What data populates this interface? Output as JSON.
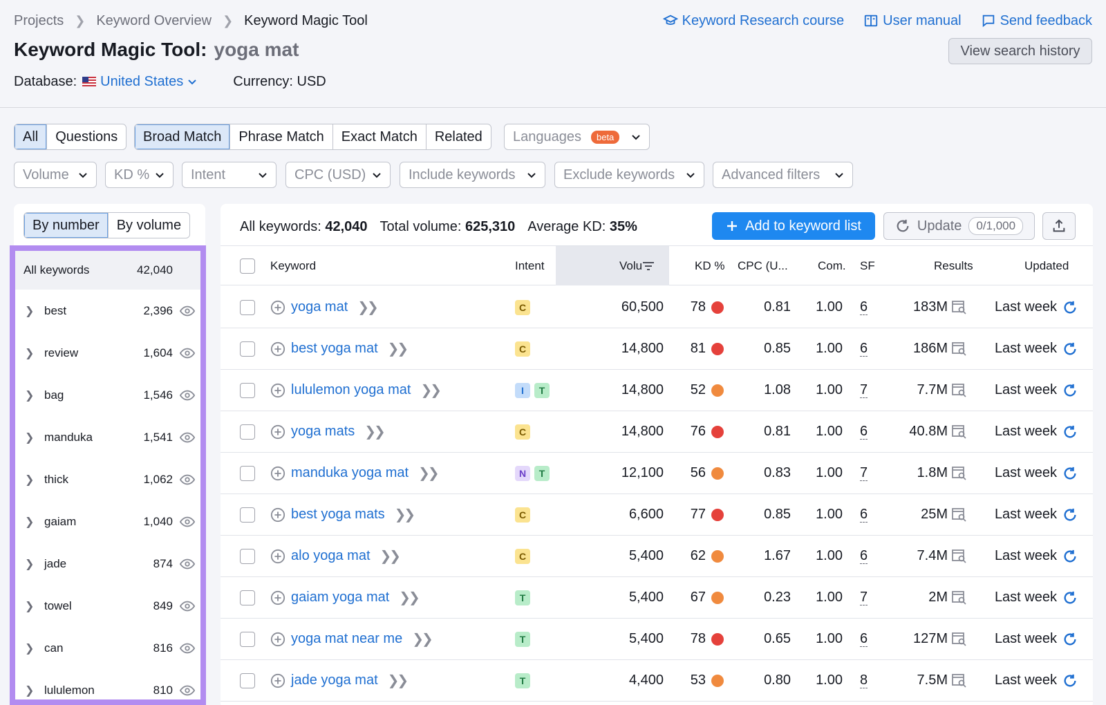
{
  "breadcrumb": [
    "Projects",
    "Keyword Overview",
    "Keyword Magic Tool"
  ],
  "top_links": {
    "course": "Keyword Research course",
    "manual": "User manual",
    "feedback": "Send feedback"
  },
  "title": {
    "label": "Keyword Magic Tool:",
    "query": "yoga mat"
  },
  "view_history": "View search history",
  "database": {
    "label": "Database:",
    "value": "United States",
    "currency": "Currency: USD"
  },
  "tabs_type": [
    "All",
    "Questions"
  ],
  "tabs_match": [
    "Broad Match",
    "Phrase Match",
    "Exact Match",
    "Related"
  ],
  "languages": {
    "label": "Languages",
    "badge": "beta"
  },
  "filters": [
    "Volume",
    "KD %",
    "Intent",
    "CPC (USD)",
    "Include keywords",
    "Exclude keywords",
    "Advanced filters"
  ],
  "left": {
    "by_number": "By number",
    "by_volume": "By volume",
    "all_label": "All keywords",
    "all_count": "42,040",
    "groups": [
      {
        "name": "best",
        "count": "2,396"
      },
      {
        "name": "review",
        "count": "1,604"
      },
      {
        "name": "bag",
        "count": "1,546"
      },
      {
        "name": "manduka",
        "count": "1,541"
      },
      {
        "name": "thick",
        "count": "1,062"
      },
      {
        "name": "gaiam",
        "count": "1,040"
      },
      {
        "name": "jade",
        "count": "874"
      },
      {
        "name": "towel",
        "count": "849"
      },
      {
        "name": "can",
        "count": "816"
      },
      {
        "name": "lululemon",
        "count": "810"
      }
    ]
  },
  "summary": {
    "all_label": "All keywords:",
    "all_value": "42,040",
    "vol_label": "Total volume:",
    "vol_value": "625,310",
    "kd_label": "Average KD:",
    "kd_value": "35%"
  },
  "actions": {
    "add": "Add to keyword list",
    "update": "Update",
    "update_count": "0/1,000"
  },
  "columns": {
    "keyword": "Keyword",
    "intent": "Intent",
    "volume": "Volu",
    "kd": "KD %",
    "cpc": "CPC (U...",
    "com": "Com.",
    "sf": "SF",
    "results": "Results",
    "updated": "Updated"
  },
  "colors": {
    "red": "#e5413b",
    "orange": "#f08a3e",
    "accent": "#1e88f0",
    "highlight": "#b28cf0"
  },
  "rows": [
    {
      "keyword": "yoga mat",
      "intent": [
        "C"
      ],
      "volume": "60,500",
      "kd": "78",
      "kd_color": "red",
      "cpc": "0.81",
      "com": "1.00",
      "sf": "6",
      "results": "183M",
      "updated": "Last week"
    },
    {
      "keyword": "best yoga mat",
      "intent": [
        "C"
      ],
      "volume": "14,800",
      "kd": "81",
      "kd_color": "red",
      "cpc": "0.85",
      "com": "1.00",
      "sf": "6",
      "results": "186M",
      "updated": "Last week"
    },
    {
      "keyword": "lululemon yoga mat",
      "intent": [
        "I",
        "T"
      ],
      "volume": "14,800",
      "kd": "52",
      "kd_color": "orange",
      "cpc": "1.08",
      "com": "1.00",
      "sf": "7",
      "results": "7.7M",
      "updated": "Last week"
    },
    {
      "keyword": "yoga mats",
      "intent": [
        "C"
      ],
      "volume": "14,800",
      "kd": "76",
      "kd_color": "red",
      "cpc": "0.81",
      "com": "1.00",
      "sf": "6",
      "results": "40.8M",
      "updated": "Last week"
    },
    {
      "keyword": "manduka yoga mat",
      "intent": [
        "N",
        "T"
      ],
      "volume": "12,100",
      "kd": "56",
      "kd_color": "orange",
      "cpc": "0.83",
      "com": "1.00",
      "sf": "7",
      "results": "1.8M",
      "updated": "Last week"
    },
    {
      "keyword": "best yoga mats",
      "intent": [
        "C"
      ],
      "volume": "6,600",
      "kd": "77",
      "kd_color": "red",
      "cpc": "0.85",
      "com": "1.00",
      "sf": "6",
      "results": "25M",
      "updated": "Last week"
    },
    {
      "keyword": "alo yoga mat",
      "intent": [
        "C"
      ],
      "volume": "5,400",
      "kd": "62",
      "kd_color": "orange",
      "cpc": "1.67",
      "com": "1.00",
      "sf": "6",
      "results": "7.4M",
      "updated": "Last week"
    },
    {
      "keyword": "gaiam yoga mat",
      "intent": [
        "T"
      ],
      "volume": "5,400",
      "kd": "67",
      "kd_color": "orange",
      "cpc": "0.23",
      "com": "1.00",
      "sf": "7",
      "results": "2M",
      "updated": "Last week"
    },
    {
      "keyword": "yoga mat near me",
      "intent": [
        "T"
      ],
      "volume": "5,400",
      "kd": "78",
      "kd_color": "red",
      "cpc": "0.65",
      "com": "1.00",
      "sf": "6",
      "results": "127M",
      "updated": "Last week"
    },
    {
      "keyword": "jade yoga mat",
      "intent": [
        "T"
      ],
      "volume": "4,400",
      "kd": "53",
      "kd_color": "orange",
      "cpc": "0.80",
      "com": "1.00",
      "sf": "8",
      "results": "7.5M",
      "updated": "Last week"
    }
  ]
}
